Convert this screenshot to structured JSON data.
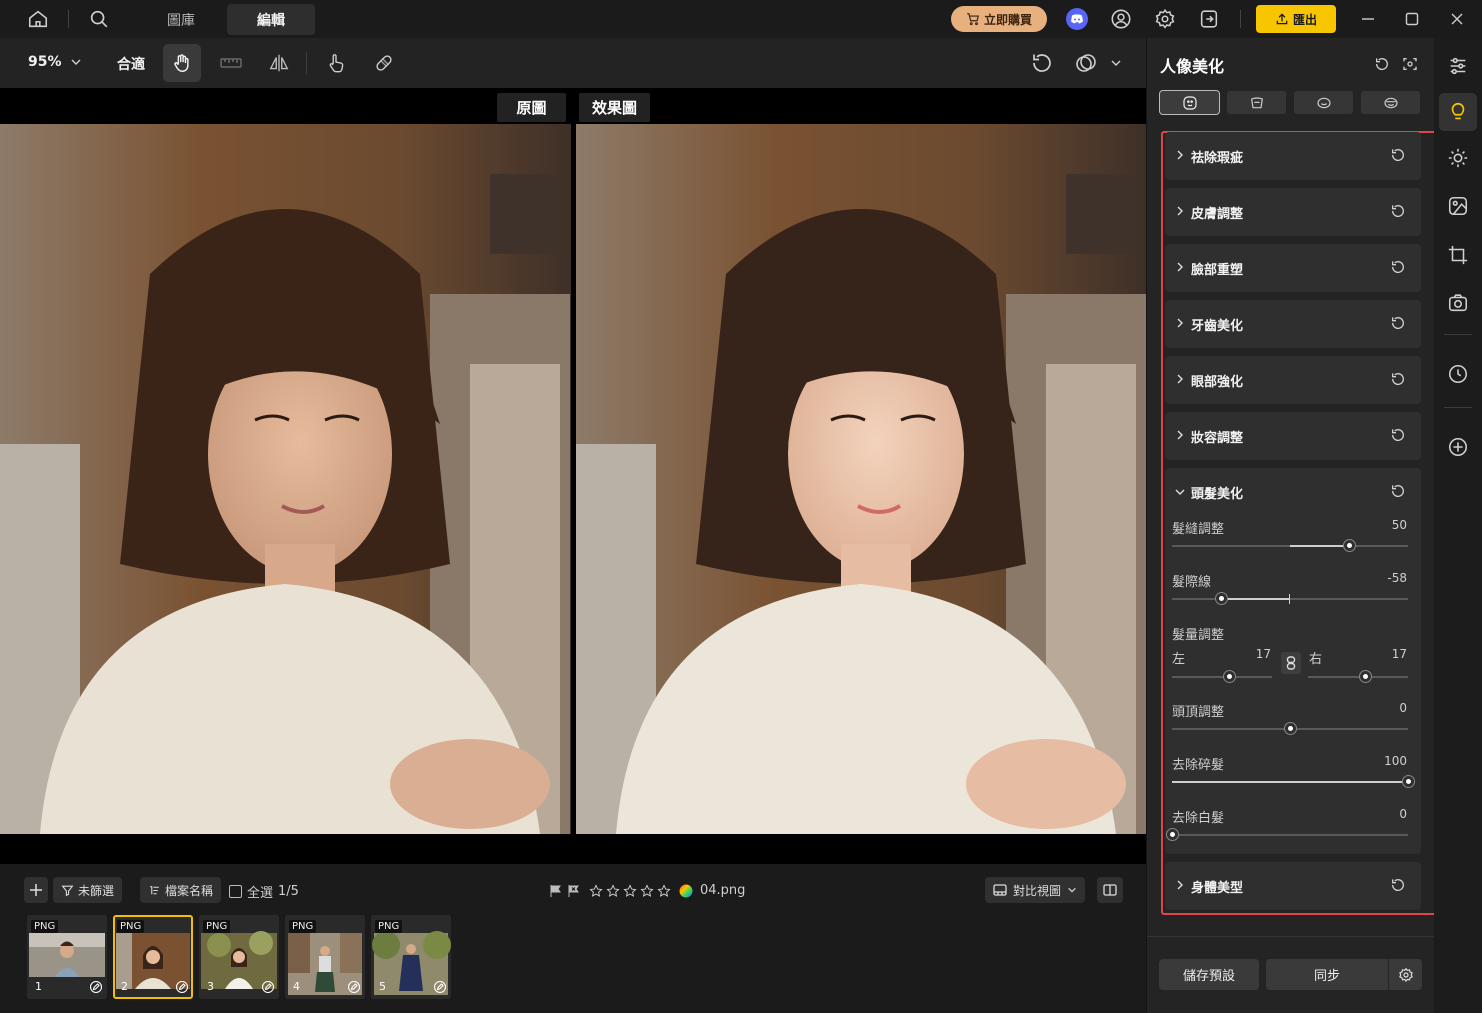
{
  "titlebar": {
    "tabs": [
      "圖庫",
      "編輯"
    ],
    "buy_label": "立即購買",
    "export_label": "匯出",
    "accent_export": "#f7c600",
    "accent_buy": "#e8b07c"
  },
  "toolbar": {
    "zoom": "95%",
    "fit_label": "合適"
  },
  "canvas": {
    "original_label": "原圖",
    "effect_label": "效果圖"
  },
  "filmbar": {
    "filter_label": "未篩選",
    "sort_label": "檔案名稱",
    "select_all_label": "全選",
    "count": "1/5",
    "filename": "04.png",
    "view_label": "對比視圖",
    "thumbnails": [
      {
        "badge": "PNG",
        "num": "1"
      },
      {
        "badge": "PNG",
        "num": "2"
      },
      {
        "badge": "PNG",
        "num": "3"
      },
      {
        "badge": "PNG",
        "num": "4"
      },
      {
        "badge": "PNG",
        "num": "5"
      }
    ]
  },
  "panel": {
    "title": "人像美化",
    "sections": [
      "祛除瑕疵",
      "皮膚調整",
      "臉部重塑",
      "牙齒美化",
      "眼部強化",
      "妝容調整",
      "頭髮美化",
      "身體美型"
    ],
    "hair": {
      "sliders": [
        {
          "label": "髮縫調整",
          "value": "50",
          "level": 0.5
        },
        {
          "label": "髮際線",
          "value": "-58",
          "level": -0.58
        },
        {
          "label": "頭頂調整",
          "value": "0",
          "level": 0
        },
        {
          "label": "去除碎髮",
          "value": "100",
          "level": 1
        },
        {
          "label": "去除白髮",
          "value": "0",
          "level": 0
        }
      ],
      "volume": {
        "label": "髮量調整",
        "left_label": "左",
        "left_value": "17",
        "right_label": "右",
        "right_value": "17"
      }
    },
    "save_preset_label": "儲存預設",
    "sync_label": "同步",
    "highlight_color": "#e0454a"
  }
}
